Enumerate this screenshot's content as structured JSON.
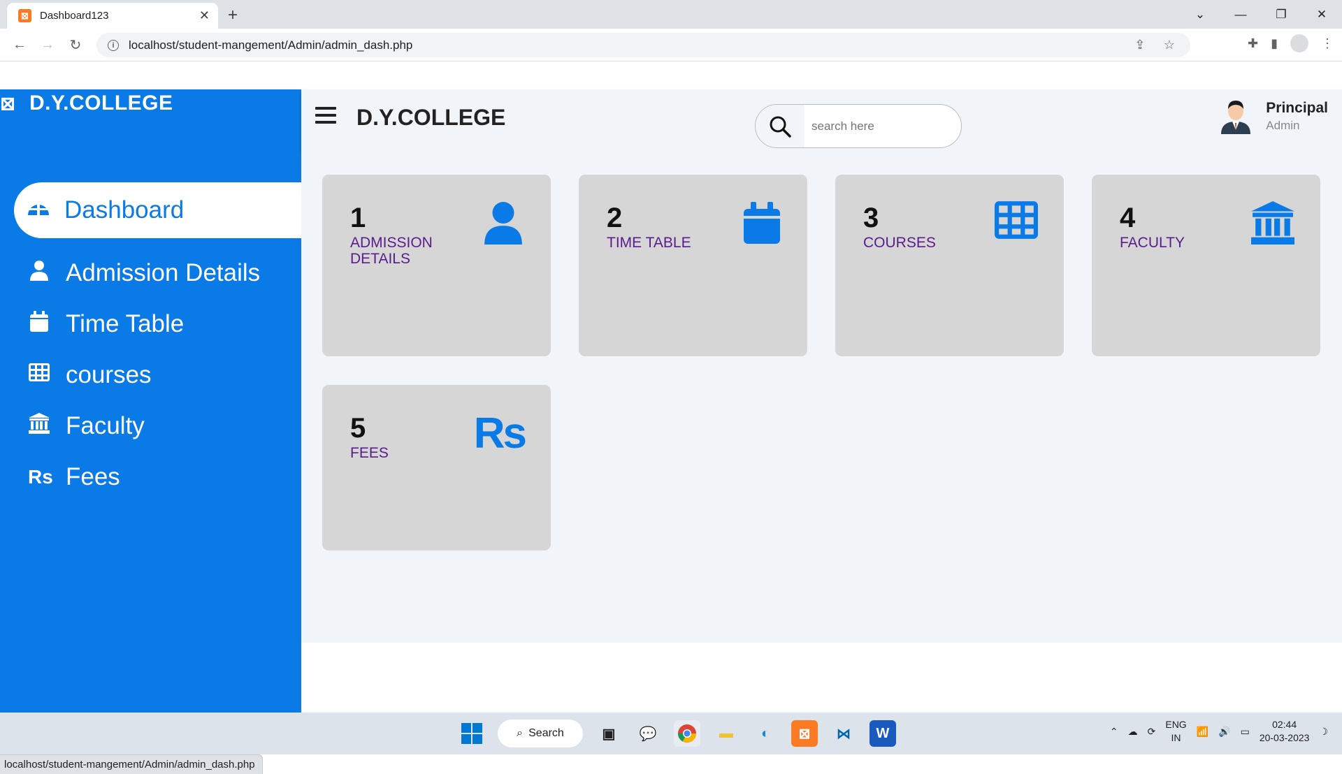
{
  "browser": {
    "tab_title": "Dashboard123",
    "url": "localhost/student-mangement/Admin/admin_dash.php",
    "status_link": "localhost/student-mangement/Admin/admin_dash.php"
  },
  "sidebar": {
    "brand": "D.Y.COLLEGE",
    "items": [
      {
        "label": "Dashboard",
        "icon": "dashboard-icon",
        "active": true
      },
      {
        "label": "Admission Details",
        "icon": "user-icon"
      },
      {
        "label": "Time Table",
        "icon": "calendar-icon"
      },
      {
        "label": "courses",
        "icon": "grid-icon"
      },
      {
        "label": "Faculty",
        "icon": "bank-icon"
      },
      {
        "label": "Fees",
        "icon": "rupee-icon"
      }
    ]
  },
  "topbar": {
    "title": "D.Y.COLLEGE",
    "search_placeholder": "search here",
    "user_name": "Principal",
    "user_role": "Admin"
  },
  "cards": [
    {
      "number": "1",
      "label": "ADMISSION DETAILS",
      "icon": "user-icon"
    },
    {
      "number": "2",
      "label": "TIME TABLE",
      "icon": "calendar-icon"
    },
    {
      "number": "3",
      "label": "COURSES",
      "icon": "grid-icon"
    },
    {
      "number": "4",
      "label": "FACULTY",
      "icon": "bank-icon"
    },
    {
      "number": "5",
      "label": "FEES",
      "icon": "rupee-icon"
    }
  ],
  "taskbar": {
    "search_label": "Search",
    "lang_top": "ENG",
    "lang_bottom": "IN",
    "time": "02:44",
    "date": "20-03-2023"
  },
  "colors": {
    "accent": "#0a7ae6",
    "card_bg": "#d6d6d6",
    "label_purple": "#5a1c8a",
    "content_bg": "#f1f4f9"
  }
}
